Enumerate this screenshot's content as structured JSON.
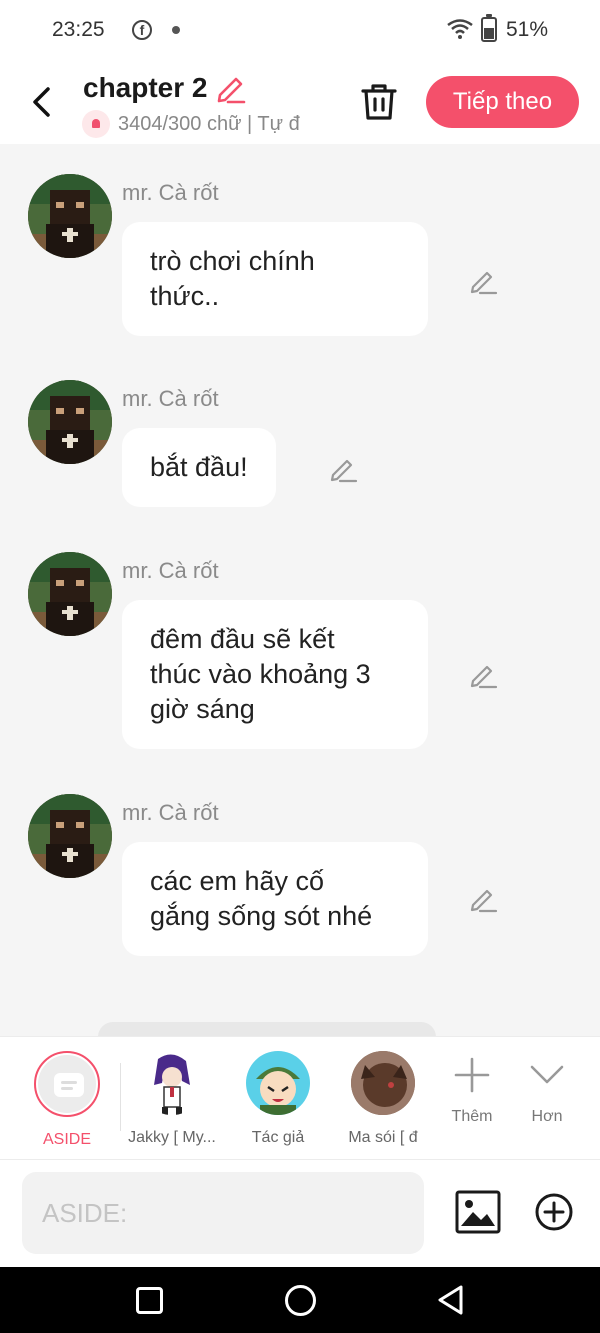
{
  "status_bar": {
    "time": "23:25",
    "battery": "51%",
    "battery_level": 0.51,
    "notification_app_icon": "facebook-icon"
  },
  "header": {
    "title": "chapter 2",
    "subtitle": "3404/300 chữ | Tự đ",
    "next_label": "Tiếp theo",
    "accent_color": "#f4506b"
  },
  "messages": [
    {
      "sender": "mr. Cà rốt",
      "text": "trò chơi chính\nthức.."
    },
    {
      "sender": "mr. Cà rốt",
      "text": "bắt đầu!"
    },
    {
      "sender": "mr. Cà rốt",
      "text": "đêm đầu sẽ kết\nthúc vào khoảng 3\ngiờ sáng"
    },
    {
      "sender": "mr. Cà rốt",
      "text": "các em hãy cố\ngắng sống sót nhé"
    }
  ],
  "characters": [
    {
      "name": "ASIDE",
      "selected": true
    },
    {
      "name": "Jakky [ My..."
    },
    {
      "name": "Tác giả"
    },
    {
      "name": "Ma sói [ đ"
    }
  ],
  "tools": {
    "add_label": "Thêm",
    "more_label": "Hơn"
  },
  "composer": {
    "placeholder": "ASIDE:"
  }
}
